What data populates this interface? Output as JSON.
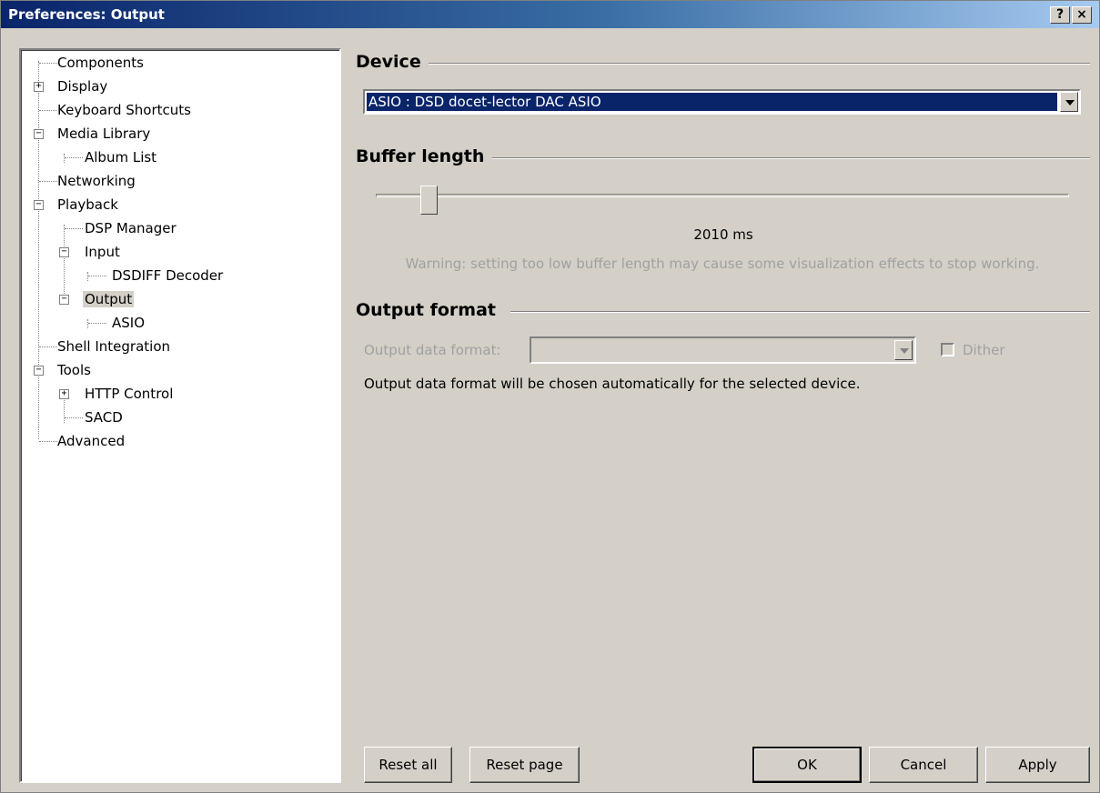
{
  "window": {
    "title": "Preferences: Output",
    "help_label": "?",
    "close_label": "×"
  },
  "tree": {
    "items": [
      {
        "label": "Components"
      },
      {
        "label": "Display"
      },
      {
        "label": "Keyboard Shortcuts"
      },
      {
        "label": "Media Library"
      },
      {
        "label": "Album List"
      },
      {
        "label": "Networking"
      },
      {
        "label": "Playback"
      },
      {
        "label": "DSP Manager"
      },
      {
        "label": "Input"
      },
      {
        "label": "DSDIFF Decoder"
      },
      {
        "label": "Output"
      },
      {
        "label": "ASIO"
      },
      {
        "label": "Shell Integration"
      },
      {
        "label": "Tools"
      },
      {
        "label": "HTTP Control"
      },
      {
        "label": "SACD"
      },
      {
        "label": "Advanced"
      }
    ],
    "selected": "Output"
  },
  "device": {
    "section_title": "Device",
    "selected": "ASIO : DSD docet-lector DAC ASIO"
  },
  "buffer": {
    "section_title": "Buffer length",
    "value_text": "2010 ms",
    "warning": "Warning: setting too low buffer length may cause some visualization effects to stop working."
  },
  "output_format": {
    "section_title": "Output format",
    "data_format_label": "Output data format:",
    "data_format_value": "",
    "dither_label": "Dither",
    "dither_checked": false,
    "note": "Output data format will be chosen automatically for the selected device."
  },
  "buttons": {
    "reset_all": "Reset all",
    "reset_page": "Reset page",
    "ok": "OK",
    "cancel": "Cancel",
    "apply": "Apply"
  }
}
